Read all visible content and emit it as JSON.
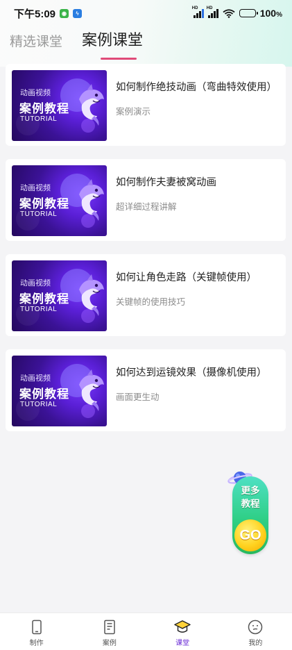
{
  "status_bar": {
    "time": "下午5:09",
    "battery": "100",
    "battery_unit": "%",
    "hd_label": "HD"
  },
  "tabs": [
    {
      "label": "精选课堂",
      "active": false
    },
    {
      "label": "案例课堂",
      "active": true
    }
  ],
  "thumbnail": {
    "subtitle": "动画视频",
    "main": "案例教程",
    "english": "TUTORIAL"
  },
  "cards": [
    {
      "title": "如何制作绝技动画（弯曲特效使用）",
      "subtitle": "案例演示"
    },
    {
      "title": "如何制作夫妻被窝动画",
      "subtitle": "超详细过程讲解"
    },
    {
      "title": "如何让角色走路（关键帧使用）",
      "subtitle": "关键帧的使用技巧"
    },
    {
      "title": "如何达到运镜效果（摄像机使用）",
      "subtitle": "画面更生动"
    }
  ],
  "floating": {
    "line1": "更多",
    "line2": "教程",
    "go": "GO"
  },
  "bottom_nav": [
    {
      "label": "制作",
      "icon": "phone-icon",
      "active": false
    },
    {
      "label": "案例",
      "icon": "document-icon",
      "active": false
    },
    {
      "label": "课堂",
      "icon": "graduation-cap-icon",
      "active": true
    },
    {
      "label": "我的",
      "icon": "smiley-icon",
      "active": false
    }
  ],
  "colors": {
    "accent": "#e04a78",
    "active_nav": "#6a2cd6",
    "float_green": "#2fcf86",
    "go_yellow": "#ffd21f"
  }
}
